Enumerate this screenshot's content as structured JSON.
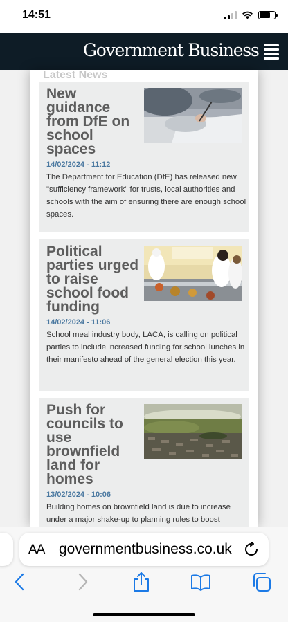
{
  "status_bar": {
    "time": "14:51"
  },
  "header": {
    "logo": "Government Business",
    "menu_icon": "hamburger-menu-icon"
  },
  "latest_news": {
    "title": "Latest News",
    "articles": [
      {
        "title": "New guidance from DfE on school spaces",
        "date": "14/02/2024 - 11:12",
        "summary": "The Department for Education (DfE) has released new \"sufficiency framework\" for trusts, local authorities and schools with the aim of ensuring there are enough school spaces.",
        "image": "students-writing-exam-photo"
      },
      {
        "title": "Political parties urged to raise school food funding",
        "date": "14/02/2024 - 11:06",
        "summary": "School meal industry body, LACA, is calling on political parties to include increased funding for school lunches in their manifesto ahead of the general election this year.",
        "image": "school-canteen-photo"
      },
      {
        "title": "Push for councils to use brownfield land for homes",
        "date": "13/02/2024 - 10:06",
        "summary": "Building homes on brownfield land is due to increase under a major shake-up to planning rules to boost",
        "image": "aerial-town-photo"
      }
    ]
  },
  "browser": {
    "text_size_label": "AA",
    "url": "governmentbusiness.co.uk",
    "toolbar": [
      "back-icon",
      "forward-icon",
      "share-icon",
      "bookmarks-icon",
      "tabs-icon"
    ]
  }
}
